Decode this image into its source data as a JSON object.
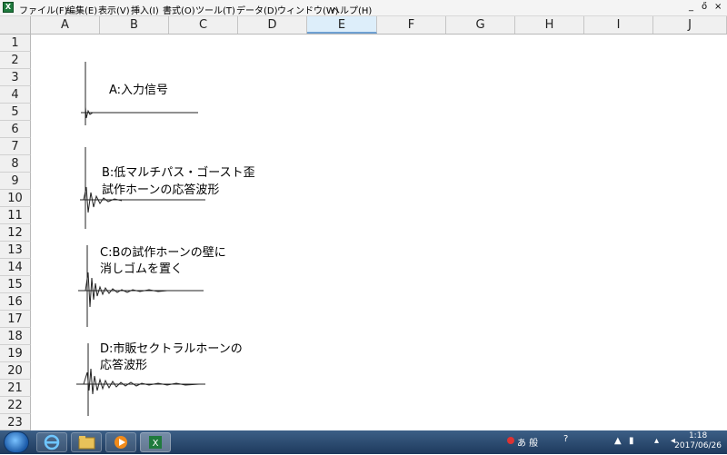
{
  "menu": {
    "items": [
      "ファイル(F)",
      "編集(E)",
      "表示(V)",
      "挿入(I)",
      "書式(O)",
      "ツール(T)",
      "データ(D)",
      "ウィンドウ(W)",
      "ヘルプ(H)"
    ],
    "window_controls": [
      "_",
      "ő",
      "×"
    ]
  },
  "columns": [
    "A",
    "B",
    "C",
    "D",
    "E",
    "F",
    "G",
    "H",
    "I",
    "J"
  ],
  "selected_column": "E",
  "rows": [
    "1",
    "2",
    "3",
    "4",
    "5",
    "6",
    "7",
    "8",
    "9",
    "10",
    "11",
    "12",
    "13",
    "14",
    "15",
    "16",
    "17",
    "18",
    "19",
    "20",
    "21",
    "22",
    "23"
  ],
  "annotations": {
    "a": [
      "A:入力信号"
    ],
    "b": [
      "B:低マルチパス・ゴースト歪",
      "試作ホーンの応答波形"
    ],
    "c": [
      "C:Bの試作ホーンの壁に",
      "消しゴムを置く"
    ],
    "d": [
      "D:市販セクトラルホーンの",
      "応答波形"
    ]
  },
  "taskbar": {
    "tray_text": "あ 般",
    "clock_time": "1:18",
    "clock_date": "2017/06/26"
  },
  "colors": {
    "excel_green": "#1f7a3d",
    "selected_header": "#ddeefa",
    "taskbar": "#1e3a5d"
  }
}
